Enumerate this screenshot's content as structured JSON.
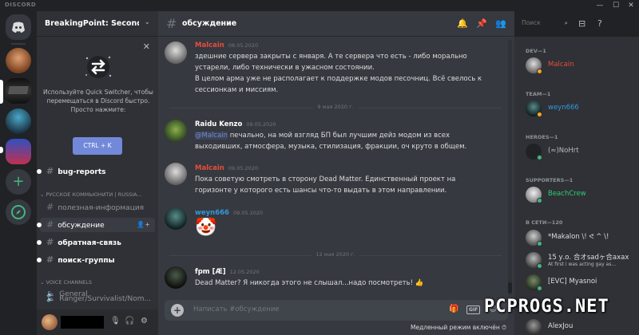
{
  "titlebar": {
    "brand": "DISCORD",
    "minimize": "—",
    "maximize": "☐",
    "close": "✕"
  },
  "server": {
    "name": "BreakingPoint: Second W..."
  },
  "quick_switcher": {
    "text": "Используйте Quick Switcher, чтобы перемещаться в Discord быстро. Просто нажмите:",
    "button": "CTRL + K"
  },
  "channels": {
    "bug_reports": "bug-reports",
    "category_ru": "РУССКОЕ КОММЬЮНИТИ | RUSSIA...",
    "items": [
      {
        "label": "полезная-информация"
      },
      {
        "label": "обсуждение"
      },
      {
        "label": "обратная-связь"
      },
      {
        "label": "поиск-группы"
      }
    ],
    "category_voice": "VOICE CHANNELS",
    "voice": [
      {
        "label": "General"
      },
      {
        "label": "Ranger/Survivalist/Nom..."
      }
    ]
  },
  "chat": {
    "channel": "обсуждение",
    "messages": [
      {
        "author": "Malcain",
        "time": "08.05.2020",
        "color": "#e74c3c",
        "lines": [
          "здешние сервера закрыты с января. А те сервера что есть - либо морально",
          "устарели, либо технически в ужасном состоянии.",
          "В целом арма уже не располагает к поддержке модов песочниц. Всё свелось к",
          "сессионкам и миссиям."
        ]
      },
      {
        "author": "Raidu Kenzo",
        "time": "09.05.2020",
        "color": "#ffffff",
        "mention": "@Malcain",
        "lines": [
          " печально, на мой взгляд БП был лучшим дейз модом из всех",
          "выходивших, атмосфера, музыка, стилизация, фракции, оч круто в общем."
        ]
      },
      {
        "author": "Malcain",
        "time": "09.05.2020",
        "color": "#e74c3c",
        "lines": [
          "Пока советую смотреть в сторону Dead Matter. Единственный проект на",
          "горизонте у которого есть шансы что-то выдать в этом направлении."
        ]
      },
      {
        "author": "weyn666",
        "time": "09.05.2020",
        "color": "#3498db",
        "emoji": "🤡"
      },
      {
        "author": "fpm [Æ]",
        "time": "12.05.2020",
        "color": "#ffffff",
        "lines": [
          "Dead Matter? Я никогда этого не слышал...надо посмотреть! 👍"
        ]
      }
    ],
    "dividers": [
      "9 мая 2020 г.",
      "12 мая 2020 г."
    ],
    "composer_placeholder": "Написать #обсуждение",
    "gif_label": "GIF",
    "slowmode": "Медленный режим включён"
  },
  "search": {
    "placeholder": "Поиск"
  },
  "members": {
    "roles": [
      "DEV—1",
      "TEAM—1",
      "HEROES—1",
      "SUPPORTERS—1",
      "В СЕТИ—120"
    ],
    "list": [
      {
        "name": "Malcain",
        "color": "#e74c3c"
      },
      {
        "name": "weyn666",
        "color": "#3498db"
      },
      {
        "name": "(≈)NoHrt",
        "color": "#b9bbbe"
      },
      {
        "name": "BeachCrew",
        "color": "#2ecc71"
      },
      {
        "name": "*Makalon \\! ᕙ ^ \\!",
        "color": "#dcddde"
      },
      {
        "name": "15 у.о. 合オsadヶ合ахах",
        "color": "#dcddde",
        "sub": "At first i was acting gay as..."
      },
      {
        "name": "[EVC] Myasnoi",
        "color": "#dcddde"
      },
      {
        "name": "AlexJou",
        "color": "#dcddde"
      }
    ]
  },
  "watermark": "PCPROGS.NET"
}
